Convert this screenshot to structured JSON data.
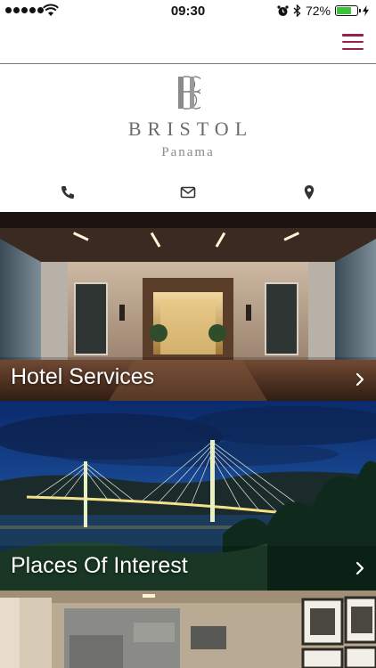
{
  "status_bar": {
    "time": "09:30",
    "battery_percent": "72%",
    "battery_level": 0.72,
    "battery_color": "#3ec13e"
  },
  "header": {
    "menu_icon": "hamburger-menu-icon",
    "accent_color": "#9b1f4c"
  },
  "brand": {
    "name": "BRISTOL",
    "location": "Panama",
    "logo_icon": "bristol-monogram-icon"
  },
  "contact": {
    "icons": [
      "phone-icon",
      "mail-icon",
      "location-pin-icon"
    ]
  },
  "tiles": [
    {
      "label": "Hotel Services",
      "icon": "chevron-right-icon"
    },
    {
      "label": "Places Of Interest",
      "icon": "chevron-right-icon"
    },
    {
      "label": "",
      "icon": ""
    }
  ]
}
